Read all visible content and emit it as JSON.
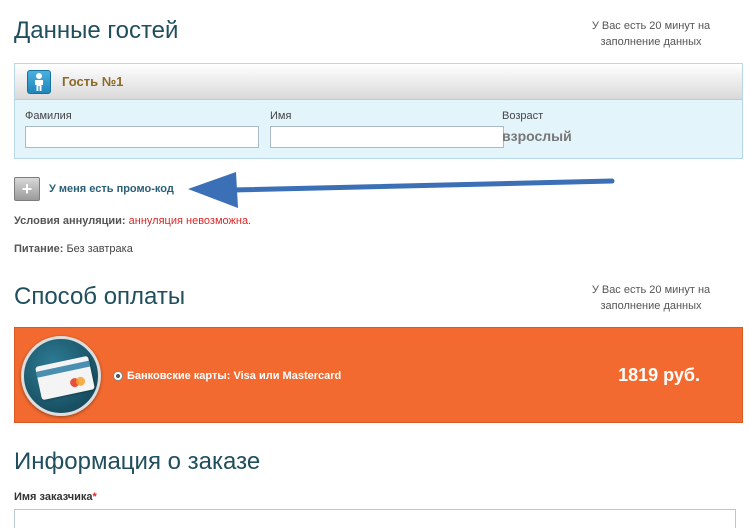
{
  "guests_section": {
    "title": "Данные гостей",
    "timer_note_line1": "У Вас есть 20 минут на",
    "timer_note_line2": "заполнение данных"
  },
  "guest": {
    "title": "Гость №1",
    "icon": "person-icon",
    "surname_label": "Фамилия",
    "surname_value": "",
    "name_label": "Имя",
    "name_value": "",
    "age_label": "Возраст",
    "age_value": "взрослый"
  },
  "promo": {
    "button_icon": "plus-icon",
    "link_text": "У меня есть промо-код"
  },
  "cancellation": {
    "label": "Условия аннуляции:",
    "value": "аннуляция невозможна."
  },
  "meals": {
    "label": "Питание:",
    "value": "Без завтрака"
  },
  "payment_section": {
    "title": "Способ оплаты",
    "timer_note_line1": "У Вас есть 20 минут на",
    "timer_note_line2": "заполнение данных"
  },
  "payment": {
    "icon": "bank-card-icon",
    "option_label": "Банковские карты: Visa или Mastercard",
    "selected": true,
    "price": "1819 руб.",
    "bar_color": "#f26a2f"
  },
  "order_info": {
    "title": "Информация о заказе",
    "customer_label": "Имя заказчика",
    "required_mark": "*",
    "customer_value": ""
  }
}
